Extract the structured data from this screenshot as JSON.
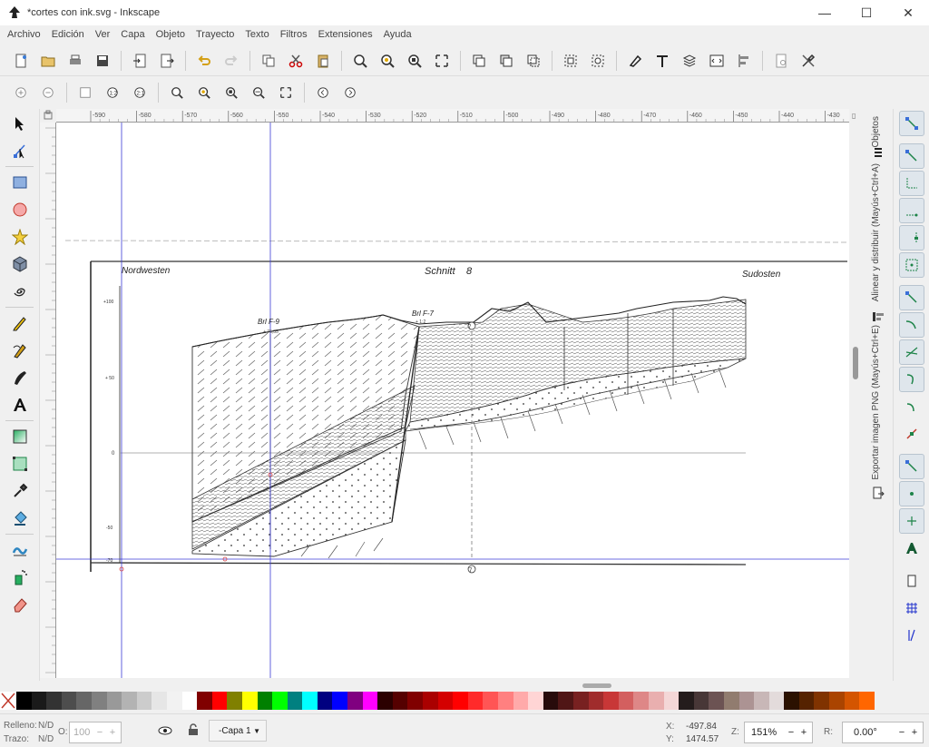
{
  "window": {
    "title": "*cortes con ink.svg - Inkscape",
    "buttons": {
      "minimize": "—",
      "maximize": "☐",
      "close": "✕"
    }
  },
  "menu": [
    "Archivo",
    "Edición",
    "Ver",
    "Capa",
    "Objeto",
    "Trayecto",
    "Texto",
    "Filtros",
    "Extensiones",
    "Ayuda"
  ],
  "ruler": {
    "h_ticks": [
      "-590",
      "-580",
      "-570",
      "-560",
      "-550",
      "-540",
      "-530",
      "-520",
      "-510",
      "-500",
      "-490",
      "-480",
      "-470",
      "-460",
      "-450",
      "-440",
      "-430"
    ]
  },
  "docks": {
    "objetos": "Objetos",
    "alinear": "Alinear y distribuir (Mayús+Ctrl+A)",
    "exportar": "Exportar imagen PNG (Mayús+Ctrl+E)"
  },
  "drawing": {
    "label_nw": "Nordwesten",
    "label_title": "Schnitt",
    "label_title_num": "8",
    "label_se": "Sudosten",
    "bore_f9": "Brl F-9",
    "bore_f9_elev": "+ 75,35",
    "bore_f7": "Brl F-7",
    "bore_f7_elev": "+ 1:2",
    "ticks": [
      "+100",
      "+ 50",
      "0",
      "-50",
      "-70"
    ],
    "marker_top": "7",
    "marker_bottom": "7"
  },
  "palette": [
    "#000000",
    "#1a1a1a",
    "#333333",
    "#4d4d4d",
    "#666666",
    "#808080",
    "#999999",
    "#b3b3b3",
    "#cccccc",
    "#e6e6e6",
    "#f2f2f2",
    "#ffffff",
    "#800000",
    "#ff0000",
    "#808000",
    "#ffff00",
    "#008000",
    "#00ff00",
    "#008080",
    "#00ffff",
    "#000080",
    "#0000ff",
    "#800080",
    "#ff00ff",
    "#2b0000",
    "#550000",
    "#800000",
    "#aa0000",
    "#d40000",
    "#ff0000",
    "#ff2a2a",
    "#ff5555",
    "#ff8080",
    "#ffaaaa",
    "#ffd5d5",
    "#280b0b",
    "#501616",
    "#782121",
    "#a02c2c",
    "#c83737",
    "#d35f5f",
    "#de8787",
    "#e9afaf",
    "#f4d7d7",
    "#241c1c",
    "#483737",
    "#6c5353",
    "#917c6f",
    "#ac9393",
    "#c8b7b7",
    "#e3dbdb",
    "#2b1100",
    "#552200",
    "#803300",
    "#aa4400",
    "#d45500",
    "#ff6600"
  ],
  "status": {
    "fill_label": "Relleno:",
    "fill_value": "N/D",
    "stroke_label": "Trazo:",
    "stroke_value": "N/D",
    "opacity_label": "O:",
    "opacity_value": "100",
    "layer": "-Capa 1",
    "x_label": "X:",
    "x_value": "-497.84",
    "y_label": "Y:",
    "y_value": "1474.57",
    "zoom_label": "Z:",
    "zoom_value": "151%",
    "rot_label": "R:",
    "rot_value": "0.00°"
  }
}
